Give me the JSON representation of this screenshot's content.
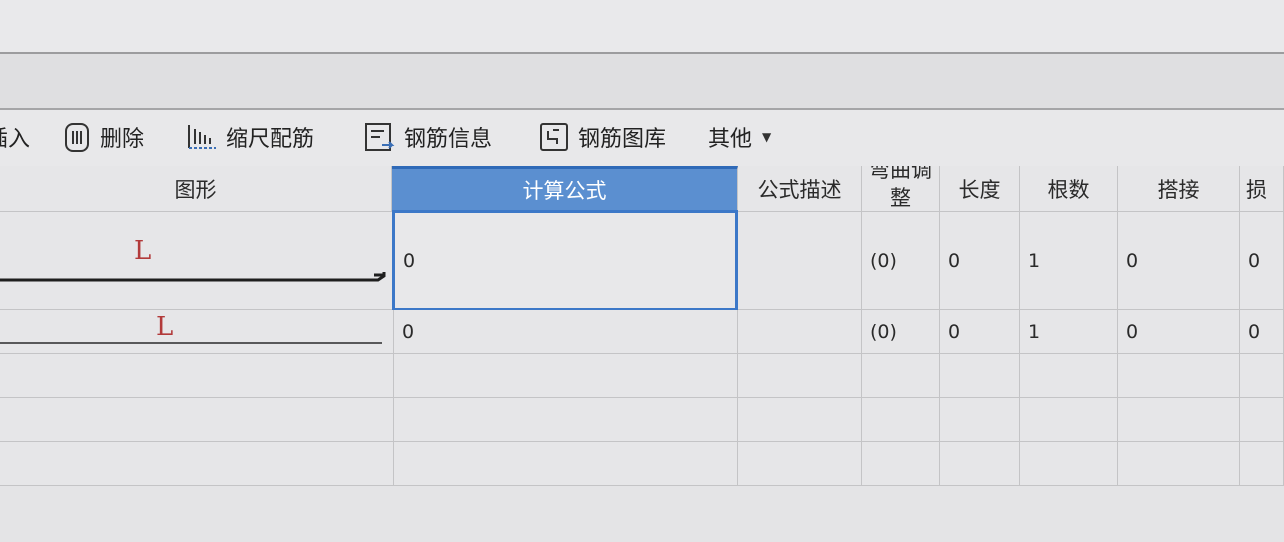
{
  "toolbar": {
    "insert_partial": "插入",
    "delete": "删除",
    "scale_rebar": "缩尺配筋",
    "rebar_info": "钢筋信息",
    "rebar_library": "钢筋图库",
    "other": "其他",
    "other_dropdown_icon": "chevron-down-icon"
  },
  "table": {
    "headers": {
      "shape": "图形",
      "formula": "计算公式",
      "formula_desc": "公式描述",
      "bend_adjust_line1": "弯曲调",
      "bend_adjust_line2": "整",
      "length": "长度",
      "count": "根数",
      "lap": "搭接",
      "loss_partial": "损"
    },
    "rows": [
      {
        "shape_label": "L",
        "formula": "0",
        "formula_desc": "",
        "bend_adjust": "(0)",
        "length": "0",
        "count": "1",
        "lap": "0",
        "loss": "0"
      },
      {
        "shape_label": "L",
        "formula": "0",
        "formula_desc": "",
        "bend_adjust": "(0)",
        "length": "0",
        "count": "1",
        "lap": "0",
        "loss": "0"
      }
    ]
  },
  "colors": {
    "active_header": "#5b8fd0",
    "selection_border": "#3c78c8",
    "shape_label": "#b23a3a"
  }
}
